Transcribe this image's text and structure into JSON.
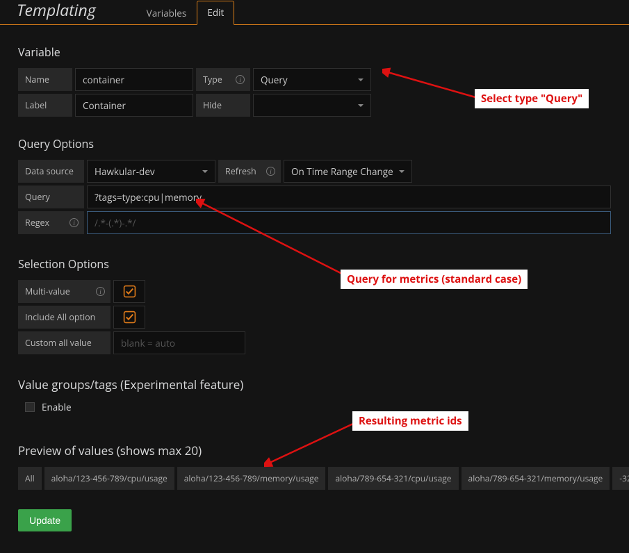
{
  "header": {
    "title": "Templating"
  },
  "tabs": {
    "items": [
      "Variables",
      "Edit"
    ],
    "active": 1
  },
  "variable": {
    "heading": "Variable",
    "name_label": "Name",
    "name_value": "container",
    "type_label": "Type",
    "type_value": "Query",
    "label_label": "Label",
    "label_value": "Container",
    "hide_label": "Hide",
    "hide_value": ""
  },
  "query_options": {
    "heading": "Query Options",
    "ds_label": "Data source",
    "ds_value": "Hawkular-dev",
    "refresh_label": "Refresh",
    "refresh_value": "On Time Range Change",
    "query_label": "Query",
    "query_value": "?tags=type:cpu|memory",
    "regex_label": "Regex",
    "regex_placeholder": "/.*-(.*)-.*/"
  },
  "selection": {
    "heading": "Selection Options",
    "multi_label": "Multi-value",
    "multi_checked": true,
    "all_label": "Include All option",
    "all_checked": true,
    "custom_label": "Custom all value",
    "custom_placeholder": "blank = auto"
  },
  "tags": {
    "heading": "Value groups/tags (Experimental feature)",
    "enable_label": "Enable"
  },
  "preview": {
    "heading": "Preview of values (shows max 20)",
    "items": [
      "All",
      "aloha/123-456-789/cpu/usage",
      "aloha/123-456-789/memory/usage",
      "aloha/789-654-321/cpu/usage",
      "aloha/789-654-321/memory/usage",
      "-32"
    ]
  },
  "buttons": {
    "update": "Update"
  },
  "annotations": {
    "a1": "Select type \"Query\"",
    "a2": "Query for metrics (standard case)",
    "a3": "Resulting metric ids"
  }
}
